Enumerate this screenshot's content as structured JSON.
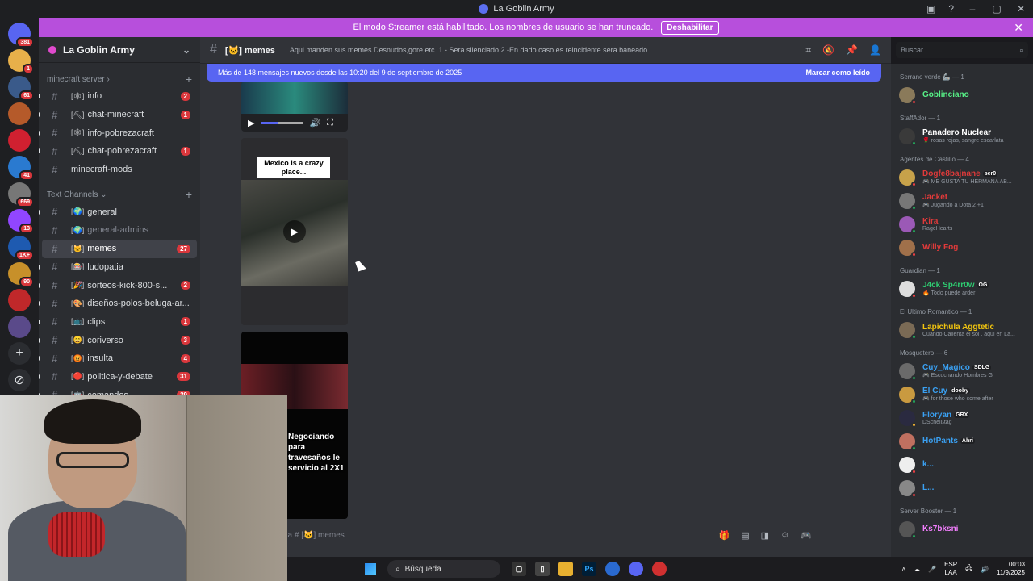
{
  "window": {
    "title": "La Goblin Army"
  },
  "banner": {
    "text": "El modo Streamer está habilitado. Los nombres de usuario se han truncado.",
    "button": "Deshabilitar"
  },
  "rail": {
    "badges": [
      "381",
      "1",
      "61",
      "",
      "",
      "41",
      "669",
      "13",
      "1K+",
      "90",
      "",
      ""
    ]
  },
  "sidebar": {
    "guild_name": "La Goblin Army",
    "cat1": "minecraft server",
    "cat2": "Text Channels",
    "channels": [
      {
        "emoji": "[🕸]",
        "name": "info",
        "count": "2"
      },
      {
        "emoji": "[⛏]",
        "name": "chat-minecraft",
        "count": "1"
      },
      {
        "emoji": "[🕸]",
        "name": "info-pobrezacraft",
        "count": ""
      },
      {
        "emoji": "[⛏]",
        "name": "chat-pobrezacraft",
        "count": "1"
      },
      {
        "emoji": "",
        "name": "minecraft-mods",
        "count": ""
      },
      {
        "emoji": "[🌍]",
        "name": "general",
        "count": ""
      },
      {
        "emoji": "[🌍]",
        "name": "general-admins",
        "count": ""
      },
      {
        "emoji": "[🐱]",
        "name": "memes",
        "count": "27"
      },
      {
        "emoji": "[🎰]",
        "name": "ludopatia",
        "count": ""
      },
      {
        "emoji": "[🎉]",
        "name": "sorteos-kick-800-s...",
        "count": "2"
      },
      {
        "emoji": "[🎨]",
        "name": "diseños-polos-beluga-ar...",
        "count": ""
      },
      {
        "emoji": "[📺]",
        "name": "clips",
        "count": "1"
      },
      {
        "emoji": "[😄]",
        "name": "coriverso",
        "count": "3"
      },
      {
        "emoji": "[😡]",
        "name": "insulta",
        "count": "4"
      },
      {
        "emoji": "[🔴]",
        "name": "politica-y-debate",
        "count": "31"
      },
      {
        "emoji": "[🤖]",
        "name": "comandos",
        "count": "39"
      }
    ]
  },
  "header": {
    "channel": "[🐱] memes",
    "topic": "Aqui manden sus memes.Desnudos,gore,etc. 1.- Sera silenciado 2.-En dado caso es reincidente sera baneado",
    "search_placeholder": "Buscar"
  },
  "chat": {
    "new_messages": "Más de 148 mensajes nuevos desde las 10:20 del 9 de septiembre de 2025",
    "mark_read": "Marcar como leído",
    "video2_caption": "Mexico is a crazy place...",
    "video3_caption": "Negociando para travesaños le servicio al 2X1",
    "composer_placeholder": "je a # [🐱] memes"
  },
  "members": {
    "groups": [
      {
        "title": "Serrano verde 🦾 — 1",
        "members": [
          {
            "name": "Goblinciano",
            "color": "#57f287",
            "status": "",
            "tag": "",
            "st": "dnd",
            "av": "#8a7a5a"
          }
        ]
      },
      {
        "title": "StaffAdor — 1",
        "members": [
          {
            "name": "Panadero Nuclear",
            "color": "#ffffff",
            "status": "🌹 rosas rojas, sangre escarlata",
            "tag": "",
            "st": "online",
            "av": "#3a3a3a"
          }
        ]
      },
      {
        "title": "Agentes de Castillo — 4",
        "members": [
          {
            "name": "Dogfe8bajnane",
            "color": "#e03a3a",
            "status": "🎮 ME GUSTA TU HERMANA AB...",
            "tag": "ser0",
            "st": "dnd",
            "av": "#c7a24a"
          },
          {
            "name": "Jacket",
            "color": "#e03a3a",
            "status": "🎮 Jugando a Dota 2 +1",
            "tag": "",
            "st": "online",
            "av": "#777"
          },
          {
            "name": "Kira",
            "color": "#e03a3a",
            "status": "RageHearts",
            "tag": "",
            "st": "online",
            "av": "#9b59b6"
          },
          {
            "name": "Willy Fog",
            "color": "#e03a3a",
            "status": "",
            "tag": "",
            "st": "dnd",
            "av": "#a0704a"
          }
        ]
      },
      {
        "title": "Guardian — 1",
        "members": [
          {
            "name": "J4ck Sp4rr0w",
            "color": "#2ecc71",
            "status": "🔥 Todo puede arder",
            "tag": "OG",
            "st": "dnd",
            "av": "#ddd"
          }
        ]
      },
      {
        "title": "El Ultimo Romantico — 1",
        "members": [
          {
            "name": "Lapichula Aggtetic",
            "color": "#f1c40f",
            "status": "Cuando Calienta el sol , aqui en La...",
            "tag": "",
            "st": "online",
            "av": "#7a6a55"
          }
        ]
      },
      {
        "title": "Mosquetero — 6",
        "members": [
          {
            "name": "Cuy_Magico",
            "color": "#3aa0f2",
            "status": "🎮 Escuchando Hombres G",
            "tag": "SDLG",
            "st": "online",
            "av": "#6a6a6a"
          },
          {
            "name": "El Cuy",
            "color": "#3aa0f2",
            "status": "🎮 for those who come after",
            "tag": "dooby",
            "st": "online",
            "av": "#c99a40"
          },
          {
            "name": "Floryan",
            "color": "#3aa0f2",
            "status": "DScheißtag",
            "tag": "GRX",
            "st": "idle",
            "av": "#2a2a40"
          },
          {
            "name": "HotPants",
            "color": "#3aa0f2",
            "status": "",
            "tag": "Ahri",
            "st": "online",
            "av": "#c07060"
          },
          {
            "name": "k...",
            "color": "#3aa0f2",
            "status": "",
            "tag": "",
            "st": "dnd",
            "av": "#eee"
          },
          {
            "name": "L...",
            "color": "#3aa0f2",
            "status": "",
            "tag": "",
            "st": "dnd",
            "av": "#888"
          }
        ]
      },
      {
        "title": "Server Booster — 1",
        "members": [
          {
            "name": "Ks7bksni",
            "color": "#f47fff",
            "status": "",
            "tag": "",
            "st": "online",
            "av": "#555"
          }
        ]
      }
    ]
  },
  "taskbar": {
    "search": "Búsqueda",
    "lang1": "ESP",
    "lang2": "LAA",
    "time": "00:03",
    "date": "11/9/2025"
  }
}
